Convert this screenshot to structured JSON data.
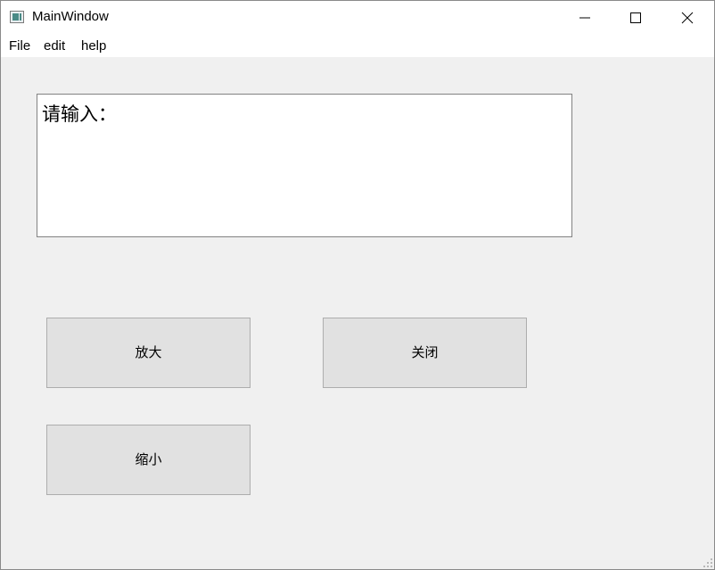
{
  "window": {
    "title": "MainWindow",
    "icon": "app-window-icon",
    "controls": {
      "minimize_icon": "minimize-icon",
      "maximize_icon": "maximize-icon",
      "close_icon": "close-icon"
    }
  },
  "menubar": {
    "items": [
      {
        "label": "File"
      },
      {
        "label": "edit"
      },
      {
        "label": "help"
      }
    ]
  },
  "main": {
    "text_edit": {
      "value": "请输入："
    },
    "buttons": {
      "zoom_in": "放大",
      "close": "关闭",
      "zoom_out": "缩小"
    }
  },
  "colors": {
    "window_background": "#f0f0f0",
    "button_background": "#e1e1e1",
    "button_border": "#adadad"
  }
}
